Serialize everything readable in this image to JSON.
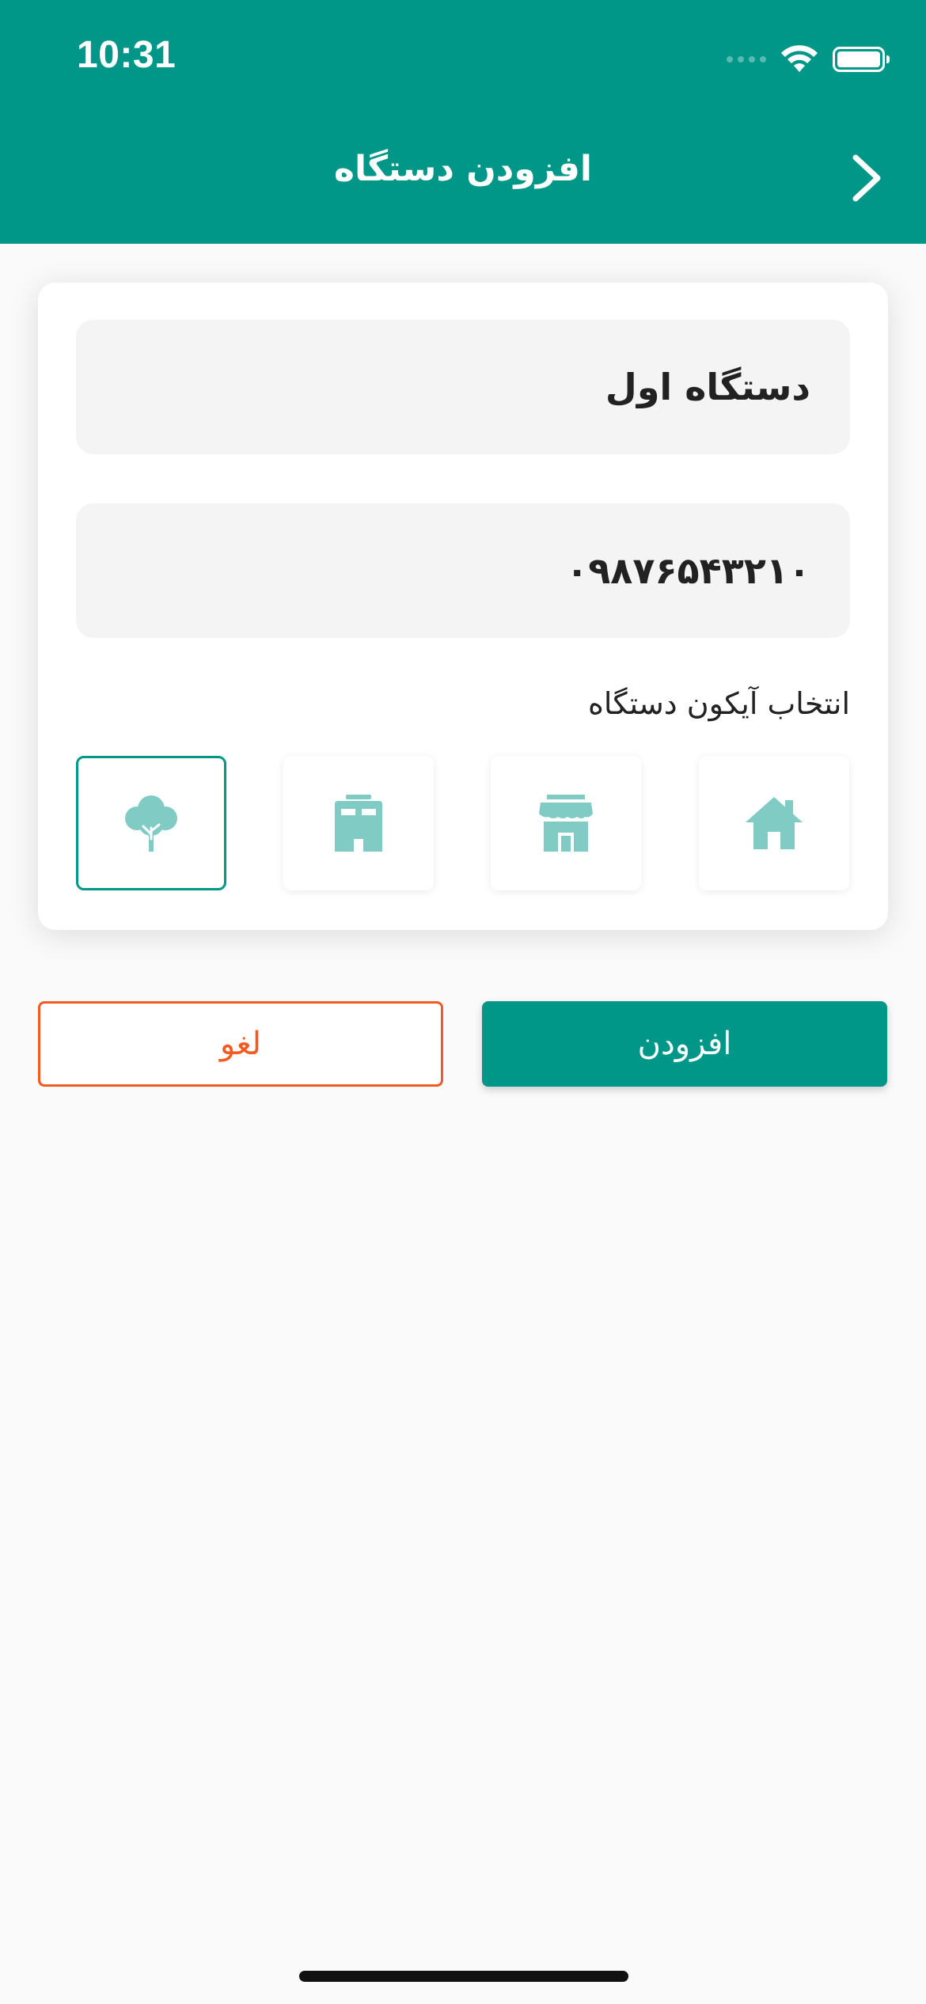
{
  "status_bar": {
    "time": "10:31"
  },
  "header": {
    "title": "افزودن دستگاه",
    "back_icon": "chevron-right-icon"
  },
  "form": {
    "device_name_value": "دستگاه اول",
    "phone_value": "۰۹۸۷۶۵۴۳۲۱۰",
    "icon_section_label": "انتخاب آیکون دستگاه",
    "icons": [
      {
        "name": "home-icon",
        "selected": false
      },
      {
        "name": "shop-icon",
        "selected": false
      },
      {
        "name": "building-icon",
        "selected": false
      },
      {
        "name": "tree-icon",
        "selected": true
      }
    ]
  },
  "actions": {
    "add_label": "افزودن",
    "cancel_label": "لغو"
  },
  "colors": {
    "primary": "#009688",
    "icon_tint": "#80cbc4",
    "cancel": "#f15a22",
    "background": "#fafafa"
  }
}
